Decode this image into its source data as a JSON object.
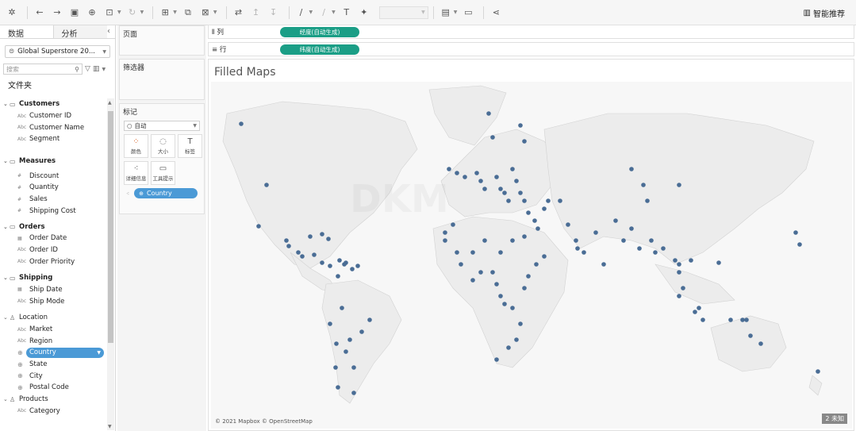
{
  "toolbar": {
    "smart_label": "智能推荐"
  },
  "data_pane": {
    "tab_data": "数据",
    "tab_analysis": "分析",
    "datasource": "Global Superstore 20...",
    "search_placeholder": "搜索",
    "folder_label": "文件夹"
  },
  "groups": {
    "customers": "Customers",
    "customer_id": "Customer ID",
    "customer_name": "Customer Name",
    "segment": "Segment",
    "measures": "Measures",
    "discount": "Discount",
    "quantity": "Quantity",
    "sales": "Sales",
    "shipping_cost": "Shipping Cost",
    "orders": "Orders",
    "order_date": "Order Date",
    "order_id": "Order ID",
    "order_priority": "Order Priority",
    "shipping": "Shipping",
    "ship_date": "Ship Date",
    "ship_mode": "Ship Mode",
    "location": "Location",
    "market": "Market",
    "region": "Region",
    "country": "Country",
    "state": "State",
    "city": "City",
    "postal_code": "Postal Code",
    "products": "Products",
    "category": "Category"
  },
  "shelves": {
    "pages": "页面",
    "filters": "筛选器",
    "marks": "标记",
    "marks_type": "自动",
    "color": "颜色",
    "size": "大小",
    "label": "标签",
    "detail": "详细信息",
    "tooltip": "工具提示",
    "detail_pill": "Country",
    "columns_label": "列",
    "rows_label": "行",
    "columns_pill": "经度(自动生成)",
    "rows_pill": "纬度(自动生成)"
  },
  "viz": {
    "title": "Filled Maps",
    "attribution": "© 2021 Mapbox © OpenStreetMap",
    "page_badge": "2 未知",
    "dot_color": "#4a6d95"
  }
}
